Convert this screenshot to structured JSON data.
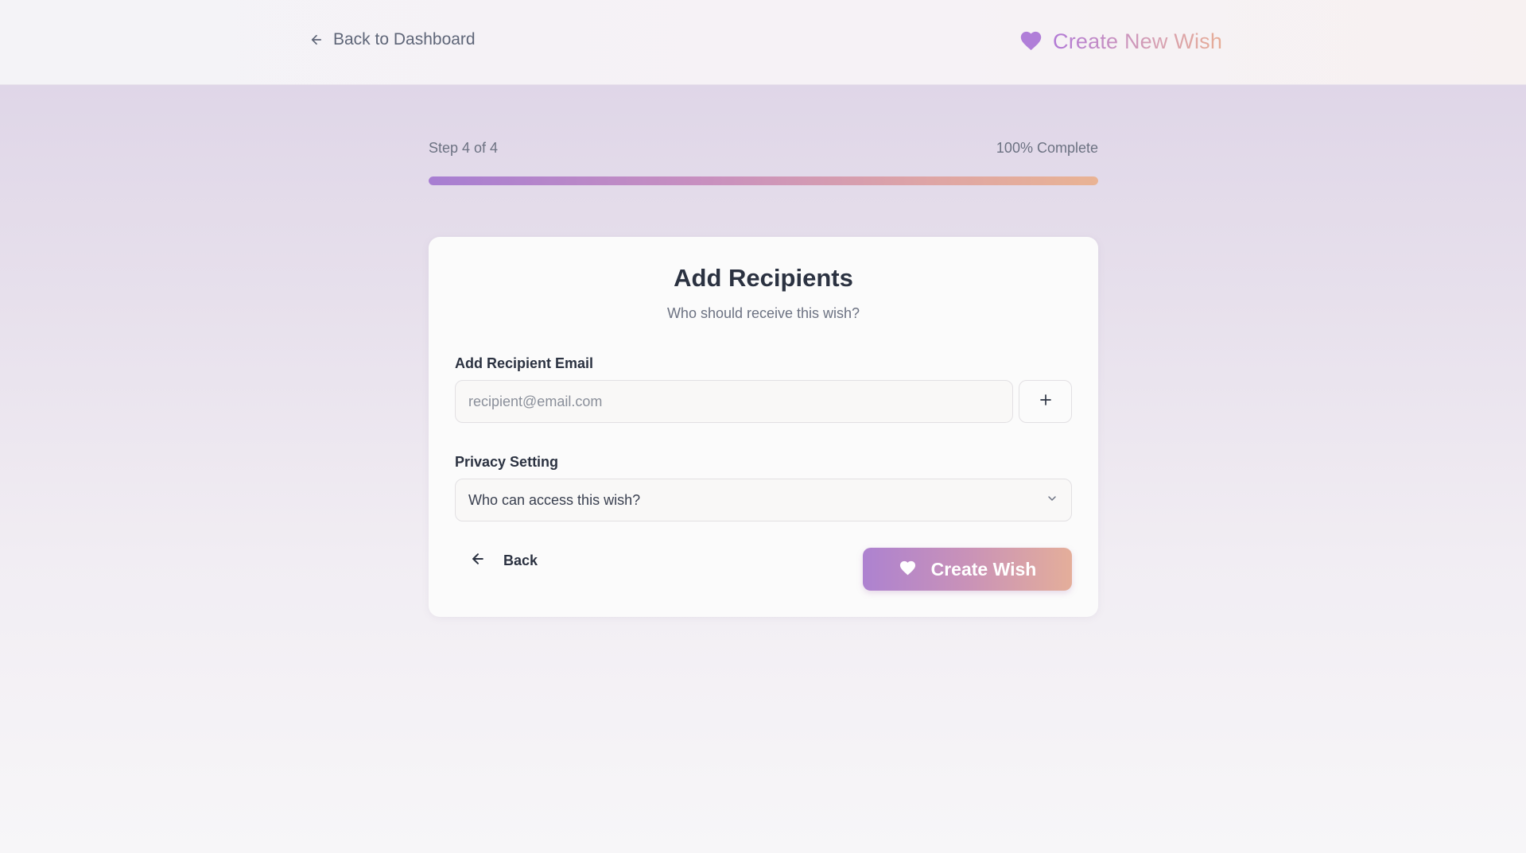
{
  "header": {
    "back_label": "Back to Dashboard",
    "title": "Create New Wish"
  },
  "progress": {
    "step_label": "Step 4 of 4",
    "percent_label": "100% Complete",
    "percent": 100
  },
  "card": {
    "title": "Add Recipients",
    "subtitle": "Who should receive this wish?",
    "email_label": "Add Recipient Email",
    "email_placeholder": "recipient@email.com",
    "email_value": "",
    "privacy_label": "Privacy Setting",
    "privacy_placeholder": "Who can access this wish?",
    "back_label": "Back",
    "create_label": "Create Wish"
  },
  "icons": {
    "back_dashboard": "arrow-left-icon",
    "brand": "heart-icon",
    "add": "plus-icon",
    "select": "chevron-down-icon",
    "back": "arrow-left-icon",
    "create": "heart-icon"
  },
  "colors": {
    "accent_start": "#ad82d0",
    "accent_end": "#e4ae9a",
    "brand_heart": "#b07ed8"
  }
}
